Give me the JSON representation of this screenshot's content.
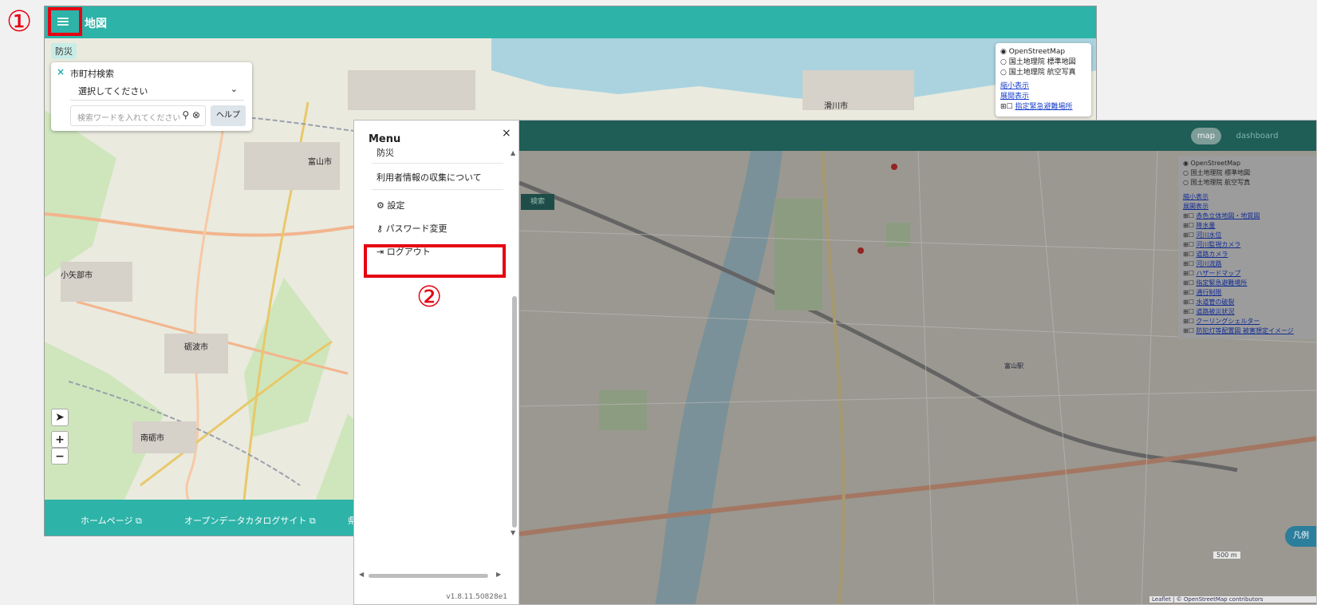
{
  "annotations": {
    "step1": "①",
    "step2": "②"
  },
  "screen1": {
    "header": {
      "menu_icon": "≡",
      "title": "地図"
    },
    "badge": "防災",
    "search": {
      "close_icon": "×",
      "label": "市町村検索",
      "select_value": "選択してください",
      "keyword_placeholder": "検索ワードを入れてください",
      "help_label": "ヘルプ"
    },
    "layers": {
      "base": [
        "OpenStreetMap",
        "国土地理院 標準地図",
        "国土地理院 航空写真"
      ],
      "shrink": "縮小表示",
      "expand": "展開表示",
      "overlay_first": "指定緊急避難場所"
    },
    "map_labels": {
      "toyama": "富山市",
      "oyabe": "小矢部市",
      "tonami": "砺波市",
      "nanto": "南砺市",
      "namerikawa": "滑川市"
    },
    "controls": {
      "locate": "➤",
      "zoom_in": "+",
      "zoom_out": "−"
    },
    "footer": {
      "homepage": "ホームページ",
      "opendata": "オープンデータカタログサイト",
      "cut": "県"
    }
  },
  "screen2": {
    "drawer": {
      "title": "Menu",
      "close": "×",
      "items": {
        "bousai": "防災",
        "privacy": "利用者情報の収集について",
        "settings": "設定",
        "password": "パスワード変更",
        "logout": "ログアウト"
      },
      "version": "v1.8.11.50828e1"
    },
    "header": {
      "map_pill": "map",
      "dashboard_pill": "dashboard"
    },
    "search_btn": "検索",
    "layers": {
      "base": [
        "OpenStreetMap",
        "国土地理院 標準地図",
        "国土地理院 航空写真"
      ],
      "shrink": "縮小表示",
      "expand": "展開表示",
      "overlays": [
        "赤色立体地図・地質図",
        "降水量",
        "河川水位",
        "河川監視カメラ",
        "道路カメラ",
        "河川流路",
        "ハザードマップ",
        "指定緊急避難場所",
        "通行制限",
        "水道管の破裂",
        "道路被災状況",
        "クーリングシェルター",
        "防犯灯等配置図 被害想定イメージ"
      ]
    },
    "map_labels": {
      "toyama_station": "富山駅",
      "legend_btn": "凡例",
      "scale": "500 m",
      "attribution": "Leaflet | © OpenStreetMap contributors"
    }
  },
  "colors": {
    "teal": "#2db3a8",
    "dark_teal": "#1f5d57",
    "annotation_red": "#e60012"
  }
}
